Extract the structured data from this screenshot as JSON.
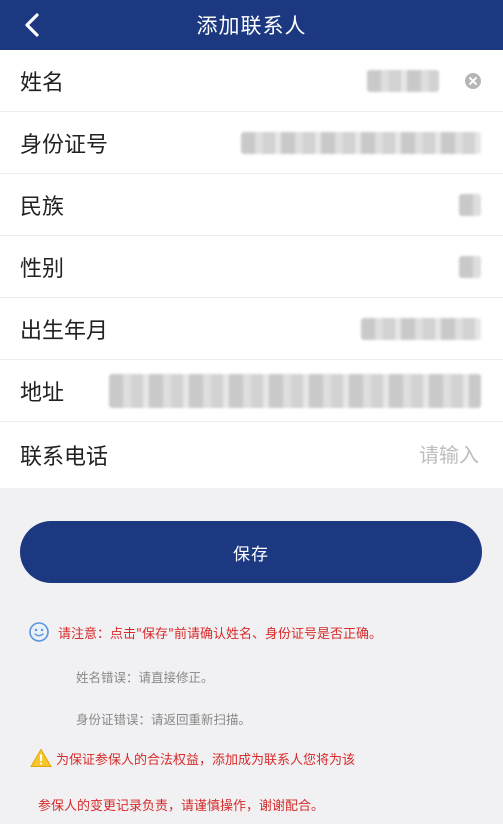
{
  "header": {
    "title": "添加联系人"
  },
  "form": {
    "fields": [
      {
        "label": "姓名"
      },
      {
        "label": "身份证号"
      },
      {
        "label": "民族"
      },
      {
        "label": "性别"
      },
      {
        "label": "出生年月"
      },
      {
        "label": "地址"
      },
      {
        "label": "联系电话",
        "placeholder": "请输入"
      }
    ]
  },
  "save_button": {
    "label": "保存"
  },
  "notice": {
    "title": "请注意：点击\"保存\"前请确认姓名、身份证号是否正确。",
    "name_error": "姓名错误：请直接修正。",
    "id_error": "身份证错误：请返回重新扫描。",
    "warning_line1": "为保证参保人的合法权益，添加成为联系人您将为该",
    "warning_line2": "参保人的变更记录负责，请谨慎操作，谢谢配合。"
  },
  "icons": {
    "back": "chevron-left-icon",
    "clear": "clear-circle-icon",
    "notice": "smile-icon",
    "warning": "warning-triangle-icon"
  },
  "colors": {
    "primary": "#1c3880",
    "warning_text": "#d82a2a",
    "hint_text": "#888888",
    "background": "#f1f1f3"
  }
}
